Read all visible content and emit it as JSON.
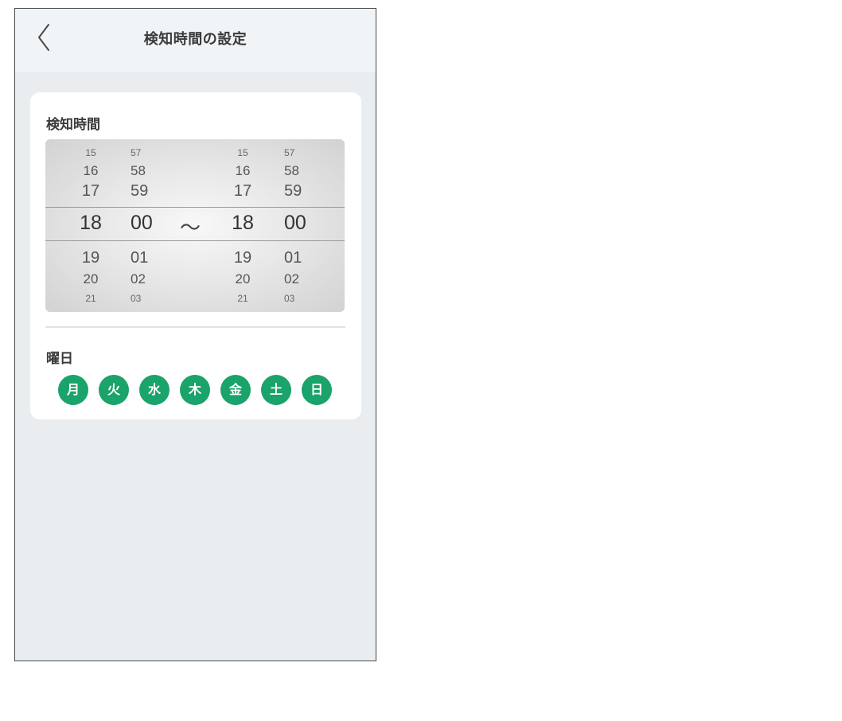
{
  "header": {
    "back_icon": "chevron-left-icon",
    "title": "検知時間の設定"
  },
  "detection_time": {
    "label": "検知時間",
    "separator": "〜",
    "start_hour": {
      "values": [
        "15",
        "16",
        "17",
        "18",
        "19",
        "20",
        "21"
      ],
      "selected": "18"
    },
    "start_minute": {
      "values": [
        "57",
        "58",
        "59",
        "00",
        "01",
        "02",
        "03"
      ],
      "selected": "00"
    },
    "end_hour": {
      "values": [
        "15",
        "16",
        "17",
        "18",
        "19",
        "20",
        "21"
      ],
      "selected": "18"
    },
    "end_minute": {
      "values": [
        "57",
        "58",
        "59",
        "00",
        "01",
        "02",
        "03"
      ],
      "selected": "00"
    }
  },
  "weekdays": {
    "label": "曜日",
    "days": [
      {
        "label": "月",
        "selected": true
      },
      {
        "label": "火",
        "selected": true
      },
      {
        "label": "水",
        "selected": true
      },
      {
        "label": "木",
        "selected": true
      },
      {
        "label": "金",
        "selected": true
      },
      {
        "label": "土",
        "selected": true
      },
      {
        "label": "日",
        "selected": true
      }
    ]
  },
  "colors": {
    "accent": "#1aa36a",
    "header_bg": "#f1f4f7",
    "page_bg": "#e9edf0",
    "card_bg": "#ffffff"
  }
}
